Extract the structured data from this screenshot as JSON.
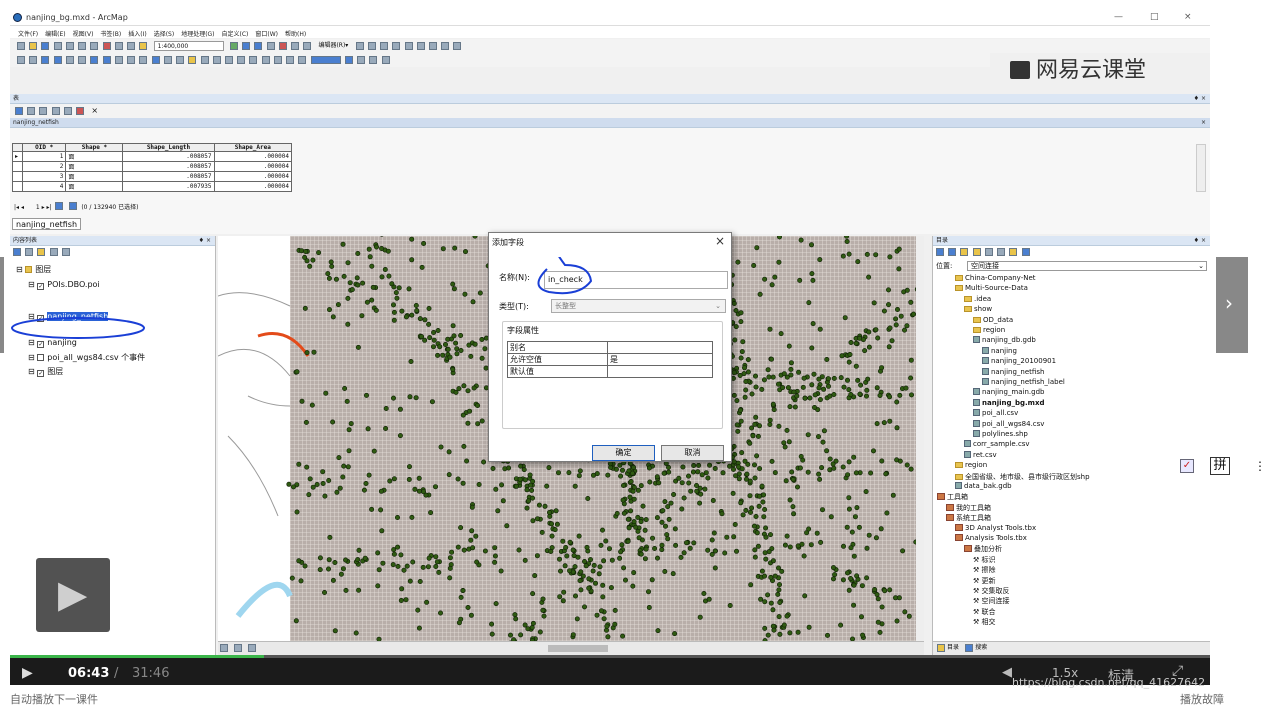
{
  "app": {
    "title": "nanjing_bg.mxd - ArcMap",
    "window_controls": [
      "—",
      "□",
      "×"
    ],
    "menu": [
      "文件(F)",
      "编辑(E)",
      "视图(V)",
      "书签(B)",
      "插入(I)",
      "选择(S)",
      "地理处理(G)",
      "自定义(C)",
      "窗口(W)",
      "帮助(H)"
    ],
    "scale": "1:400,000",
    "editor_label": "编辑器(R)▾"
  },
  "watermark": {
    "logo_text": "网易云课堂",
    "url": "https://blog.csdn.net/qq_41627642"
  },
  "table_window": {
    "title": "表",
    "layer_title": "nanjing_netfish",
    "columns": [
      "OID *",
      "Shape *",
      "Shape_Length",
      "Shape_Area"
    ],
    "rows": [
      [
        "1",
        "面",
        ".008057",
        ".000004"
      ],
      [
        "2",
        "面",
        ".008057",
        ".000004"
      ],
      [
        "3",
        "面",
        ".008057",
        ".000004"
      ],
      [
        "4",
        "面",
        ".007935",
        ".000004"
      ]
    ],
    "nav": "1 ▸ ▸|",
    "selection": "(0 / 132940 已选择)",
    "tab": "nanjing_netfish"
  },
  "toc": {
    "title": "内容列表",
    "items": [
      {
        "label": "图层",
        "indent": 0
      },
      {
        "label": "POIs.DBO.poi",
        "indent": 1
      },
      {
        "label": "nanjing_netfish",
        "indent": 1
      },
      {
        "label": "nanjing",
        "indent": 1
      },
      {
        "label": "poi_all_wgs84.csv 个事件",
        "indent": 1
      },
      {
        "label": "图层",
        "indent": 1
      }
    ]
  },
  "dialog": {
    "title": "添加字段",
    "close": "×",
    "name_label": "名称(N):",
    "name_value": "in_check",
    "type_label": "类型(T):",
    "type_value": "长整型",
    "props_title": "字段属性",
    "props": [
      {
        "k": "别名",
        "v": ""
      },
      {
        "k": "允许空值",
        "v": "是"
      },
      {
        "k": "默认值",
        "v": ""
      }
    ],
    "ok": "确定",
    "cancel": "取消"
  },
  "catalog": {
    "title": "目录",
    "location_label": "位置:",
    "location_value": "空间连接",
    "items": [
      {
        "label": "China-Company-Net",
        "indent": 2,
        "icon": "folder"
      },
      {
        "label": "Multi-Source-Data",
        "indent": 2,
        "icon": "folder"
      },
      {
        "label": ".idea",
        "indent": 3,
        "icon": "folder"
      },
      {
        "label": "show",
        "indent": 3,
        "icon": "folder"
      },
      {
        "label": "OD_data",
        "indent": 4,
        "icon": "folder"
      },
      {
        "label": "region",
        "indent": 4,
        "icon": "folder"
      },
      {
        "label": "nanjing_db.gdb",
        "indent": 4,
        "icon": "gdb"
      },
      {
        "label": "nanjing",
        "indent": 5,
        "icon": "table"
      },
      {
        "label": "nanjing_20100901",
        "indent": 5,
        "icon": "table"
      },
      {
        "label": "nanjing_netfish",
        "indent": 5,
        "icon": "table"
      },
      {
        "label": "nanjing_netfish_label",
        "indent": 5,
        "icon": "table"
      },
      {
        "label": "nanjing_main.gdb",
        "indent": 4,
        "icon": "gdb"
      },
      {
        "label": "nanjing_bg.mxd",
        "indent": 4,
        "icon": "mxd"
      },
      {
        "label": "poi_all.csv",
        "indent": 4,
        "icon": "file"
      },
      {
        "label": "poi_all_wgs84.csv",
        "indent": 4,
        "icon": "file"
      },
      {
        "label": "polylines.shp",
        "indent": 4,
        "icon": "file"
      },
      {
        "label": "corr_sample.csv",
        "indent": 3,
        "icon": "file"
      },
      {
        "label": "ret.csv",
        "indent": 3,
        "icon": "file"
      },
      {
        "label": "region",
        "indent": 2,
        "icon": "folder"
      },
      {
        "label": "全国省级、地市级、县市级行政区划shp",
        "indent": 2,
        "icon": "folder"
      },
      {
        "label": "data_bak.gdb",
        "indent": 2,
        "icon": "gdb"
      },
      {
        "label": "工具箱",
        "indent": 0,
        "icon": "tool"
      },
      {
        "label": "我的工具箱",
        "indent": 1,
        "icon": "tool"
      },
      {
        "label": "系统工具箱",
        "indent": 1,
        "icon": "tool"
      },
      {
        "label": "3D Analyst Tools.tbx",
        "indent": 2,
        "icon": "tool"
      },
      {
        "label": "Analysis Tools.tbx",
        "indent": 2,
        "icon": "tool"
      },
      {
        "label": "叠加分析",
        "indent": 3,
        "icon": "tool"
      },
      {
        "label": "标识",
        "indent": 4,
        "icon": "hammer"
      },
      {
        "label": "擦除",
        "indent": 4,
        "icon": "hammer"
      },
      {
        "label": "更新",
        "indent": 4,
        "icon": "hammer"
      },
      {
        "label": "交集取反",
        "indent": 4,
        "icon": "hammer"
      },
      {
        "label": "空间连接",
        "indent": 4,
        "icon": "hammer"
      },
      {
        "label": "联合",
        "indent": 4,
        "icon": "hammer"
      },
      {
        "label": "相交",
        "indent": 4,
        "icon": "hammer"
      }
    ],
    "tabs": [
      "目录",
      "搜索"
    ]
  },
  "player": {
    "current": "06:43",
    "separator": "/",
    "total": "31:46",
    "progress": 0.2115,
    "speed": "1.5x",
    "quality": "标清"
  },
  "ime": {
    "label": "拼"
  },
  "bottom": {
    "left": "自动播放下一课件",
    "right": "播放故障"
  }
}
